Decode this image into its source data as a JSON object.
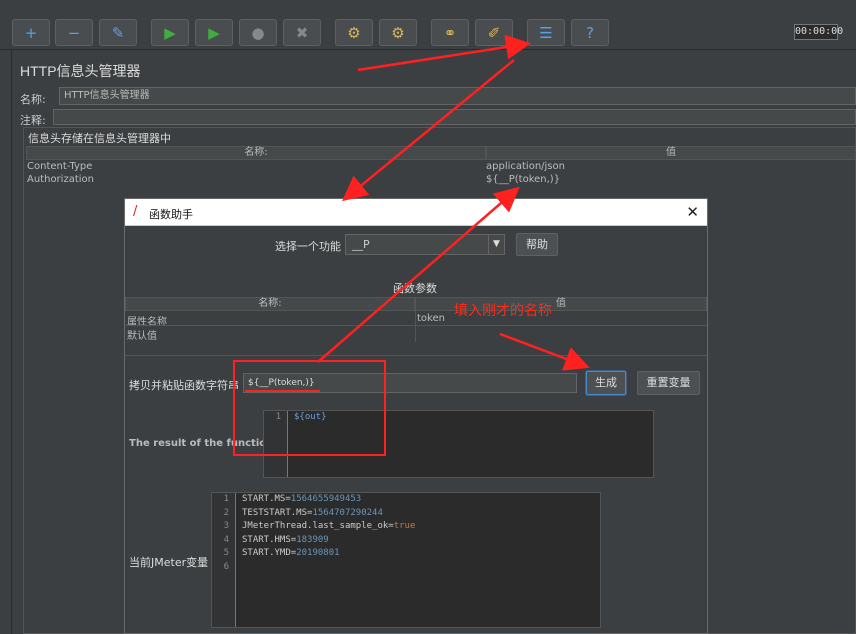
{
  "toolbar": {
    "buttons": [
      {
        "name": "add-icon",
        "glyph": "+"
      },
      {
        "name": "remove-icon",
        "glyph": "−"
      },
      {
        "name": "toggle-icon",
        "glyph": "✎"
      },
      {
        "name": "start-icon",
        "glyph": "▶"
      },
      {
        "name": "start-no-pause-icon",
        "glyph": "▶"
      },
      {
        "name": "stop-icon",
        "glyph": "●"
      },
      {
        "name": "shutdown-icon",
        "glyph": "✖"
      },
      {
        "name": "clear-icon",
        "glyph": "⚙"
      },
      {
        "name": "clear-all-icon",
        "glyph": "⚙"
      },
      {
        "name": "search-icon",
        "glyph": "⚭"
      },
      {
        "name": "reset-search-icon",
        "glyph": "✐"
      },
      {
        "name": "function-helper-icon",
        "glyph": "☰"
      },
      {
        "name": "help-icon",
        "glyph": "?"
      }
    ],
    "timer": "00:00:00"
  },
  "panel": {
    "title": "HTTP信息头管理器",
    "name_label": "名称:",
    "name_value": "HTTP信息头管理器",
    "comment_label": "注释:",
    "section_title": "信息头存储在信息头管理器中",
    "columns": [
      "名称:",
      "值"
    ],
    "rows": [
      {
        "name": "Content-Type",
        "value": "application/json"
      },
      {
        "name": "Authorization",
        "value": "${__P(token,)}"
      }
    ]
  },
  "dialog": {
    "title": "函数助手",
    "select_label": "选择一个功能",
    "select_value": "__P",
    "help_button": "帮助",
    "params_title": "函数参数",
    "param_columns": [
      "名称:",
      "值"
    ],
    "params": [
      {
        "name": "属性名称",
        "value": "token"
      },
      {
        "name": "默认值",
        "value": ""
      }
    ],
    "copy_label": "拷贝并粘贴函数字符串",
    "copy_value": "${__P(token,)}",
    "generate_button": "生成",
    "reset_button": "重置变量",
    "result_label": "The result of the function is",
    "result_line_no": "1",
    "result_text": "${out}",
    "vars_label": "当前JMeter变量",
    "vars": [
      {
        "no": "1",
        "key": "START.MS=",
        "val": "1564655949453",
        "kind": "num"
      },
      {
        "no": "2",
        "key": "TESTSTART.MS=",
        "val": "1564707290244",
        "kind": "num"
      },
      {
        "no": "3",
        "key": "JMeterThread.last_sample_ok=",
        "val": "true",
        "kind": "kw"
      },
      {
        "no": "4",
        "key": "START.HMS=",
        "val": "183909",
        "kind": "num"
      },
      {
        "no": "5",
        "key": "START.YMD=",
        "val": "20190801",
        "kind": "num"
      },
      {
        "no": "6",
        "key": "",
        "val": "",
        "kind": "num"
      }
    ]
  },
  "annotation": {
    "text": "填入刚才的名称",
    "color": "#ff2a1a"
  }
}
